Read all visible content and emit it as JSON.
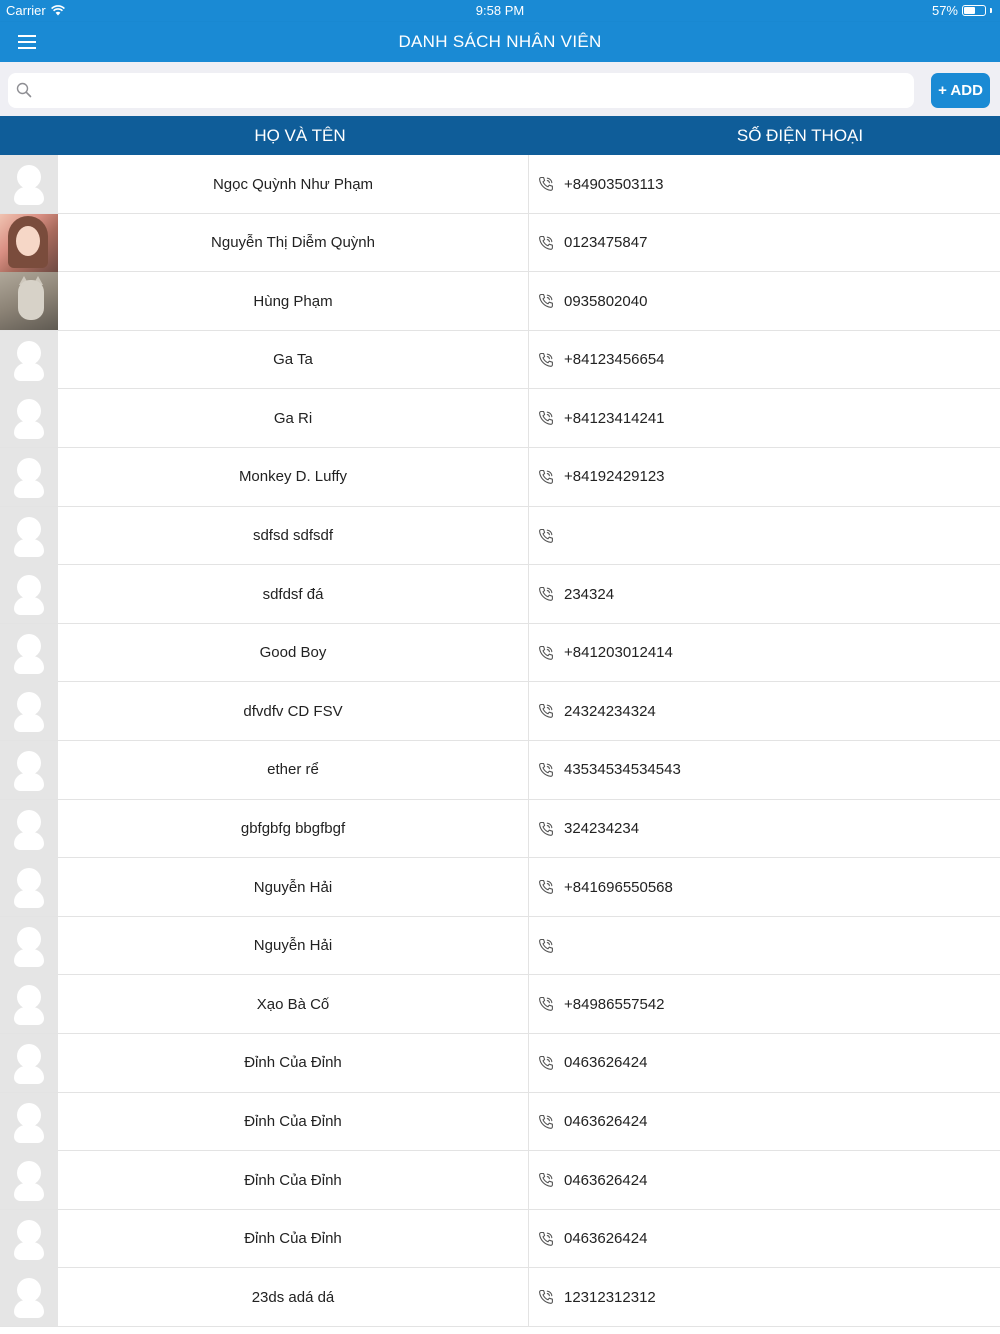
{
  "status_bar": {
    "carrier": "Carrier",
    "time": "9:58 PM",
    "battery": "57%",
    "battery_level": 0.57
  },
  "nav": {
    "title": "DANH SÁCH NHÂN VIÊN",
    "menu_icon": "hamburger-menu-icon"
  },
  "search": {
    "placeholder": "",
    "value": "",
    "icon": "search-icon"
  },
  "add_button": {
    "label": "+ ADD"
  },
  "table": {
    "headers": {
      "name": "HỌ VÀ TÊN",
      "phone": "SỐ ĐIỆN THOẠI"
    },
    "rows": [
      {
        "name": "Ngọc Quỳnh Như Phạm",
        "phone": "+84903503113",
        "avatar": "placeholder"
      },
      {
        "name": "Nguyễn Thị Diễm Quỳnh",
        "phone": "0123475847",
        "avatar": "photo-1"
      },
      {
        "name": "Hùng Phạm",
        "phone": "0935802040",
        "avatar": "photo-2"
      },
      {
        "name": "Ga Ta",
        "phone": "+84123456654",
        "avatar": "placeholder"
      },
      {
        "name": "Ga Ri",
        "phone": "+84123414241",
        "avatar": "placeholder"
      },
      {
        "name": "Monkey D. Luffy",
        "phone": "+84192429123",
        "avatar": "placeholder"
      },
      {
        "name": "sdfsd sdfsdf",
        "phone": "",
        "avatar": "placeholder"
      },
      {
        "name": "sdfdsf đá",
        "phone": "234324",
        "avatar": "placeholder"
      },
      {
        "name": "Good Boy",
        "phone": "+841203012414",
        "avatar": "placeholder"
      },
      {
        "name": "dfvdfv CD FSV",
        "phone": "24324234324",
        "avatar": "placeholder"
      },
      {
        "name": "ether rể",
        "phone": "43534534534543",
        "avatar": "placeholder"
      },
      {
        "name": "gbfgbfg bbgfbgf",
        "phone": "324234234",
        "avatar": "placeholder"
      },
      {
        "name": "Nguyễn Hải",
        "phone": "+841696550568",
        "avatar": "placeholder"
      },
      {
        "name": "Nguyễn Hải",
        "phone": "",
        "avatar": "placeholder"
      },
      {
        "name": "Xạo Bà Cố",
        "phone": "+84986557542",
        "avatar": "placeholder"
      },
      {
        "name": "Đỉnh Của Đỉnh",
        "phone": "0463626424",
        "avatar": "placeholder"
      },
      {
        "name": "Đỉnh Của Đỉnh",
        "phone": "0463626424",
        "avatar": "placeholder"
      },
      {
        "name": "Đỉnh Của Đỉnh",
        "phone": "0463626424",
        "avatar": "placeholder"
      },
      {
        "name": "Đỉnh Của Đỉnh",
        "phone": "0463626424",
        "avatar": "placeholder"
      },
      {
        "name": "23ds adá dá",
        "phone": "12312312312",
        "avatar": "placeholder"
      }
    ]
  },
  "colors": {
    "primary": "#1a8ad4",
    "header_dark": "#0f5d99",
    "search_bg": "#efeff4"
  }
}
